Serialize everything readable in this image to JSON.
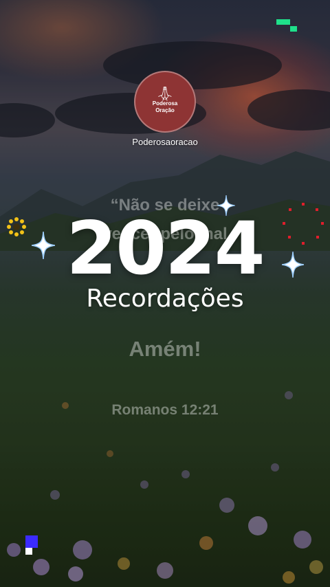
{
  "profile": {
    "avatar_line1": "Poderosa",
    "avatar_line2": "Oração",
    "username": "Poderosaoracao"
  },
  "quote": {
    "line1": "“Não se deixe",
    "line2": "vencer pelo mal",
    "amen": "Amém!",
    "reference": "Romanos 12:21"
  },
  "overlay": {
    "year": "2024",
    "subtitle": "Recordações"
  },
  "icons": {
    "avatar_symbol": "praying-hands-icon",
    "corner": "app-corner-icon",
    "sparkles": "sparkle-icon",
    "sunflower": "flower-icon",
    "firework": "firework-icon"
  },
  "colors": {
    "avatar_bg": "#8e3434",
    "corner_accent": "#1fe08a",
    "sparkle": "#ffffff",
    "firework": "#e01e2c",
    "flower": "#f2c218",
    "square_blue": "#3b2bff"
  }
}
